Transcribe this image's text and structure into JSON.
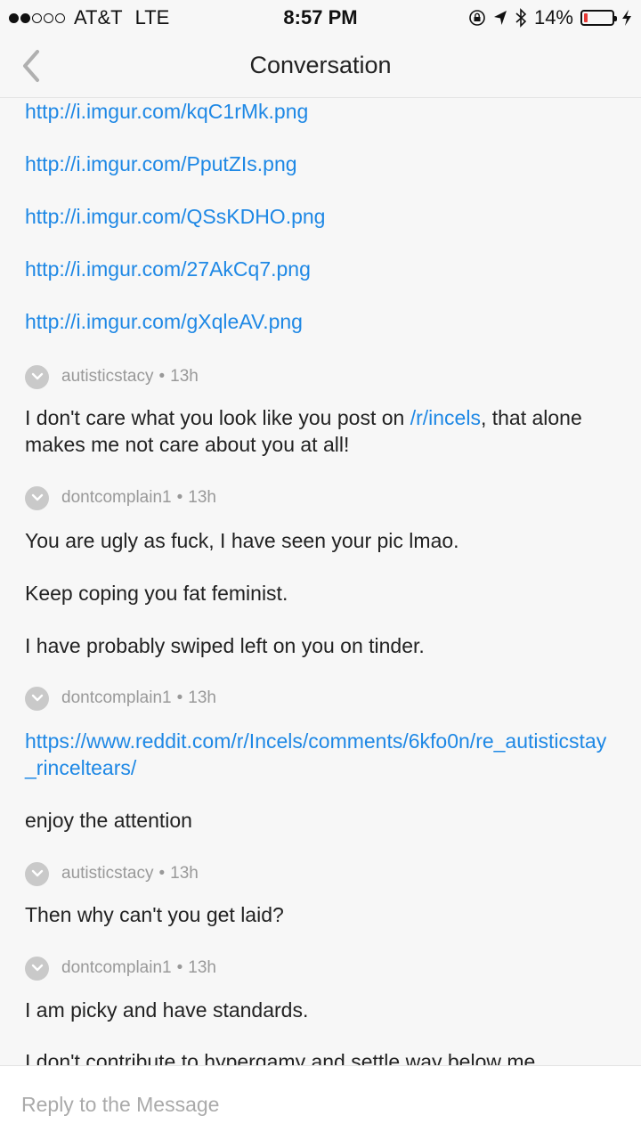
{
  "status_bar": {
    "carrier": "AT&T",
    "network": "LTE",
    "time": "8:57 PM",
    "battery": "14%",
    "battery_level": 0.14,
    "icons": [
      "signal-dots-icon",
      "rotation-lock-icon",
      "location-arrow-icon",
      "bluetooth-icon",
      "battery-icon",
      "charging-bolt-icon"
    ]
  },
  "nav": {
    "title": "Conversation",
    "back_icon": "chevron-left-icon"
  },
  "links": [
    "http://i.imgur.com/kqC1rMk.png",
    "http://i.imgur.com/PputZIs.png",
    "http://i.imgur.com/QSsKDHO.png",
    "http://i.imgur.com/27AkCq7.png",
    "http://i.imgur.com/gXqleAV.png"
  ],
  "messages": [
    {
      "user": "autisticstacy",
      "time": "13h",
      "text_before": "I don't care what you look like you post on ",
      "link": "/r/incels",
      "text_after": ", that alone makes me not care about you at all!"
    },
    {
      "user": "dontcomplain1",
      "time": "13h",
      "paragraphs": [
        "You are ugly as fuck, I have seen your pic lmao.",
        "Keep coping you fat feminist.",
        "I have probably swiped left on you on tinder."
      ]
    },
    {
      "user": "dontcomplain1",
      "time": "13h",
      "link": "https://www.reddit.com/r/Incels/comments/6kfo0n/re_autisticstay_rinceltears/",
      "paragraphs": [
        "enjoy the attention"
      ]
    },
    {
      "user": "autisticstacy",
      "time": "13h",
      "paragraphs": [
        "Then why can't you get laid?"
      ]
    },
    {
      "user": "dontcomplain1",
      "time": "13h",
      "paragraphs": [
        "I am picky and have standards.",
        "I don't contribute to hypergamy and settle way below me."
      ]
    }
  ],
  "separator": "•",
  "reply": {
    "placeholder": "Reply to the Message"
  },
  "colors": {
    "link": "#1e88e5",
    "meta": "#999999",
    "background": "#f7f7f7",
    "battery_low": "#e53935"
  }
}
